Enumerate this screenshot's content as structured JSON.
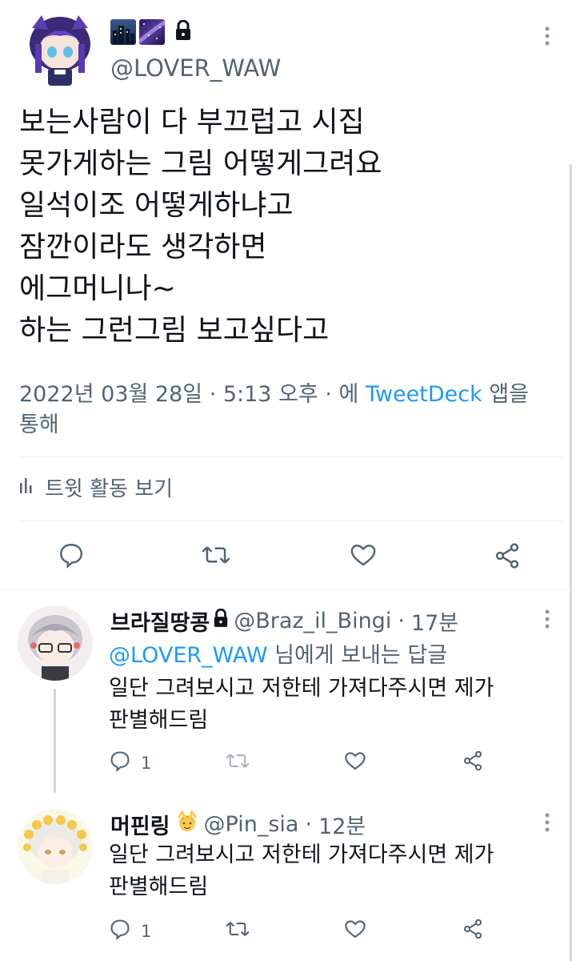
{
  "main_tweet": {
    "handle": "@LOVER_WAW",
    "name_emoji": [
      "city-night-emoji",
      "milky-way-emoji"
    ],
    "text_lines": [
      "보는사람이 다 부끄럽고 시집",
      "못가게하는 그림 어떻게그려요",
      "일석이조 어떻게하냐고",
      "잠깐이라도 생각하면",
      "에그머니나~",
      "하는 그런그림 보고싶다고"
    ],
    "meta_line1_prefix": "2022년 03월 28일 · 5:13 오후 · 에 ",
    "meta_source": "TweetDeck",
    "meta_line1_suffix": " 앱을",
    "meta_line2": "통해",
    "activity_label": "트윗 활동 보기"
  },
  "replies": [
    {
      "name": "브라질땅콩",
      "handle": "@Braz_il_Bingi",
      "time": "17분",
      "reply_to_mention": "@LOVER_WAW",
      "reply_to_suffix": " 님에게 보내는 답글",
      "text_lines": [
        "일단 그려보시고 저한테 가져다주시면 제가",
        "판별해드림"
      ],
      "reply_count": "1"
    },
    {
      "name": "머핀링",
      "handle": "@Pin_sia",
      "time": "12분",
      "text_lines": [
        "일단 그려보시고 저한테 가져다주시면 제가",
        "판별해드림"
      ],
      "reply_count": "1"
    }
  ],
  "colors": {
    "text": "#0f1419",
    "secondary": "#536471",
    "link": "#1d9bf0",
    "divider": "#eff3f4"
  }
}
